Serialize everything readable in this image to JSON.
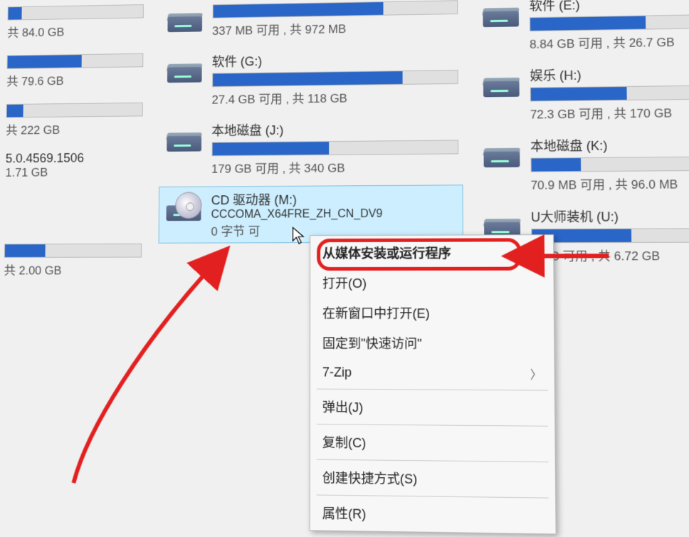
{
  "col1": [
    {
      "stats": "共 84.0 GB",
      "fill": 10
    },
    {
      "stats": "共 79.6 GB",
      "fill": 55
    },
    {
      "stats": "共 222 GB",
      "fill": 12
    },
    {
      "label_a": "5.0.4569.1506",
      "label_b": "1.71 GB"
    },
    {
      "stats": "共 2.00 GB",
      "fill": 30
    }
  ],
  "col2": [
    {
      "stats": "337 MB 可用 , 共 972 MB",
      "fill": 70
    },
    {
      "label": "软件 (G:)",
      "stats": "27.4 GB 可用 , 共 118 GB",
      "fill": 78
    },
    {
      "label": "本地磁盘 (J:)",
      "stats": "179 GB 可用 , 共 340 GB",
      "fill": 48
    },
    {
      "cd_label": "CD 驱动器 (M:)",
      "cd_sub": "CCCOMA_X64FRE_ZH_CN_DV9",
      "cd_bytes": "0 字节 可"
    }
  ],
  "col3": [
    {
      "label": "软件 (E:)",
      "stats": "8.84 GB 可用 , 共 26.7 GB",
      "fill": 70
    },
    {
      "label": "娱乐 (H:)",
      "stats": "72.3 GB 可用 , 共 170 GB",
      "fill": 58
    },
    {
      "label": "本地磁盘 (K:)",
      "stats": "70.9 MB 可用 , 共 96.0 MB",
      "fill": 30
    },
    {
      "label": "U大师装机 (U:)",
      "stats": "0 GB 可用 , 共 6.72 GB",
      "fill": 60
    }
  ],
  "menu": {
    "run_from_media": "从媒体安装或运行程序",
    "open": "打开(O)",
    "open_new_window": "在新窗口中打开(E)",
    "pin_quick_access": "固定到\"快速访问\"",
    "seven_zip": "7-Zip",
    "eject": "弹出(J)",
    "copy": "复制(C)",
    "create_shortcut": "创建快捷方式(S)",
    "properties": "属性(R)"
  }
}
